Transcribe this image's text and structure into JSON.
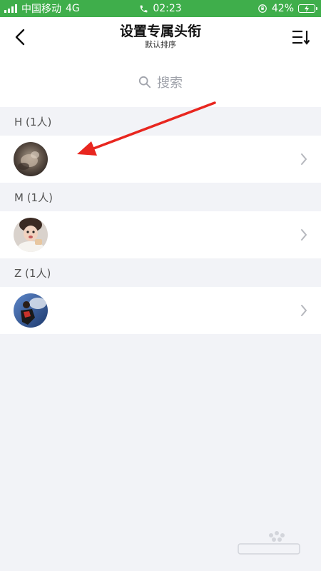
{
  "status_bar": {
    "carrier": "中国移动",
    "network": "4G",
    "time": "02:23",
    "battery": "42%"
  },
  "nav": {
    "title": "设置专属头衔",
    "subtitle": "默认排序",
    "back_icon": "back-chevron-icon",
    "sort_icon": "sort-list-icon"
  },
  "search": {
    "placeholder": "搜索",
    "icon": "search-icon"
  },
  "sections": [
    {
      "header": "H (1人)",
      "contacts": [
        {
          "name": ""
        }
      ]
    },
    {
      "header": "M (1人)",
      "contacts": [
        {
          "name": ""
        }
      ]
    },
    {
      "header": "Z (1人)",
      "contacts": [
        {
          "name": ""
        }
      ]
    }
  ],
  "colors": {
    "status_bar": "#3fae4b",
    "background": "#f2f3f7",
    "annotation_arrow": "#e8261f"
  }
}
